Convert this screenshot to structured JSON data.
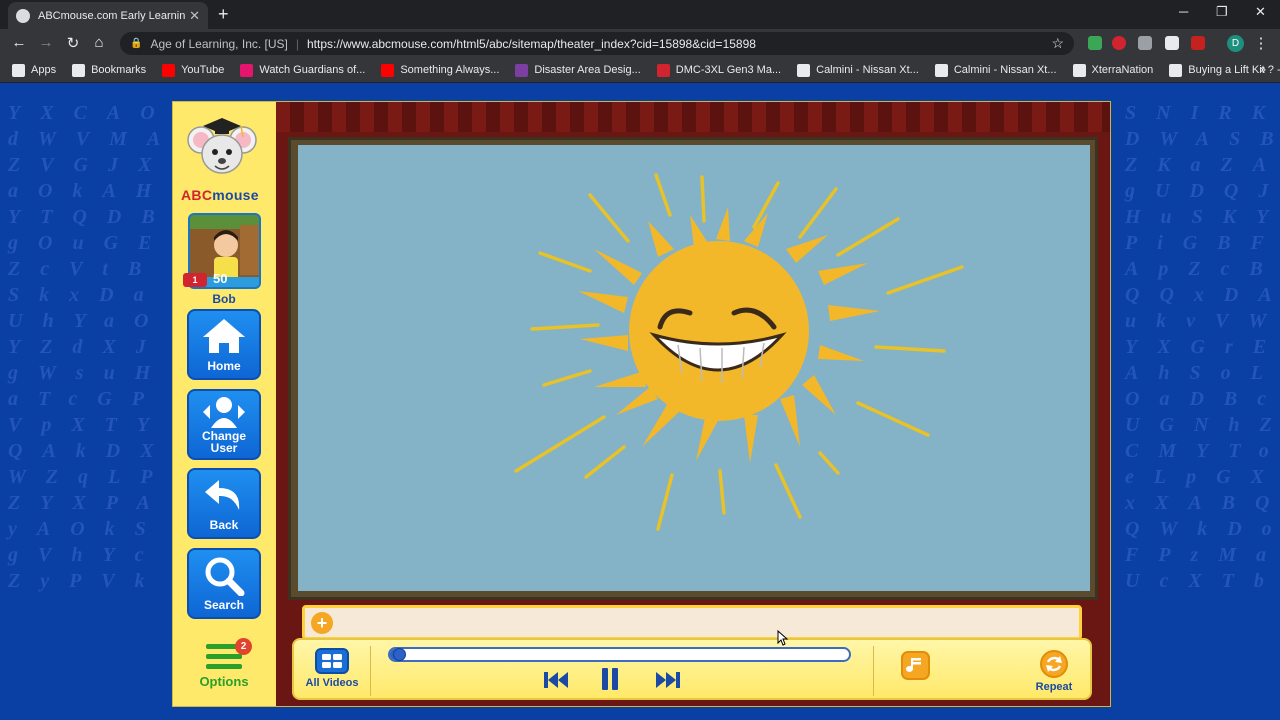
{
  "browser": {
    "tab_title": "ABCmouse.com Early Learnin",
    "new_tab": "+",
    "min": "─",
    "max": "❐",
    "close": "✕",
    "site_identity": "Age of Learning, Inc. [US]",
    "url": "https://www.abcmouse.com/html5/abc/sitemap/theater_index?cid=15898&cid=15898",
    "profile_initial": "D",
    "bookmarks": [
      {
        "label": "Apps",
        "icon_color": "#e8eaed"
      },
      {
        "label": "Bookmarks",
        "icon_color": "#e8eaed"
      },
      {
        "label": "YouTube",
        "icon_color": "#ff0000"
      },
      {
        "label": "Watch Guardians of...",
        "icon_color": "#e5156e"
      },
      {
        "label": "Something Always...",
        "icon_color": "#ff0000"
      },
      {
        "label": "Disaster Area Desig...",
        "icon_color": "#7b3fa1"
      },
      {
        "label": "DMC-3XL Gen3 Ma...",
        "icon_color": "#d2242f"
      },
      {
        "label": "Calmini - Nissan Xt...",
        "icon_color": "#e8eaed"
      },
      {
        "label": "Calmini - Nissan Xt...",
        "icon_color": "#e8eaed"
      },
      {
        "label": "XterraNation",
        "icon_color": "#e8eaed"
      },
      {
        "label": "Buying a Lift Kit ? -...",
        "icon_color": "#e8eaed"
      }
    ],
    "bookmarks_more": "»"
  },
  "sidebar": {
    "logo_abc": "ABC",
    "logo_mouse": "mouse",
    "user": {
      "name": "Bob",
      "score": "50",
      "level_badge": "1"
    },
    "nav": [
      {
        "label": "Home",
        "icon": "home-icon"
      },
      {
        "label": "Change User",
        "icon": "change-user-icon"
      },
      {
        "label": "Back",
        "icon": "back-arrow-icon"
      },
      {
        "label": "Search",
        "icon": "magnifier-icon"
      }
    ],
    "options": {
      "label": "Options",
      "count": "2"
    }
  },
  "player": {
    "add_label": "+",
    "all_videos_label": "All Videos",
    "repeat_label": "Repeat",
    "progress": 0.02,
    "state": "playing"
  },
  "colors": {
    "accent_blue": "#1a6fd6",
    "sidebar_yellow": "#ffe96a",
    "screen_bg": "#84b2c7",
    "sun": "#f2b82a"
  }
}
